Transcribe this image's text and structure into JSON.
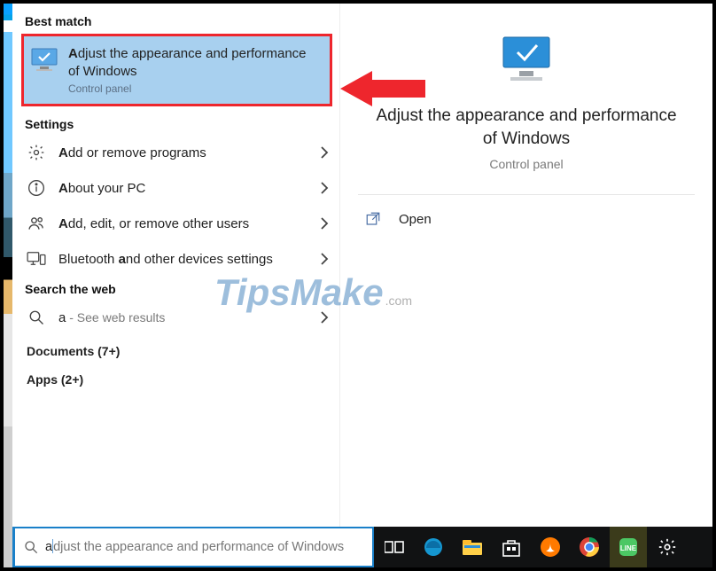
{
  "sections": {
    "best_match": "Best match",
    "settings": "Settings",
    "search_web": "Search the web",
    "documents": "Documents (7+)",
    "apps": "Apps (2+)"
  },
  "best": {
    "title": "Adjust the appearance and performance of Windows",
    "subtitle": "Control panel"
  },
  "settings_items": [
    {
      "label": "Add or remove programs"
    },
    {
      "label": "About your PC"
    },
    {
      "label": "Add, edit, or remove other users"
    },
    {
      "label": "Bluetooth and other devices settings"
    }
  ],
  "web": {
    "query": "a",
    "suffix": " - See web results"
  },
  "preview": {
    "title": "Adjust the appearance and performance of Windows",
    "subtitle": "Control panel",
    "open": "Open"
  },
  "search": {
    "typed": "a",
    "ghost": "djust the appearance and performance of Windows"
  },
  "watermark": {
    "main": "TipsMake",
    "tld": ".com"
  }
}
